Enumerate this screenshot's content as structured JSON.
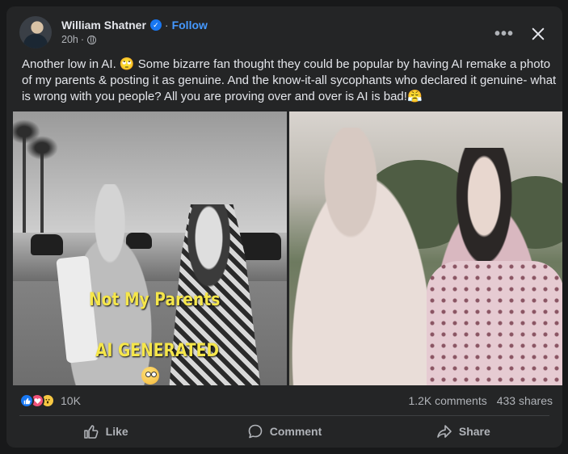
{
  "post": {
    "author": "William Shatner",
    "separator": "·",
    "follow_label": "Follow",
    "time": "20h",
    "time_separator": "·",
    "text": "Another low in AI. 🙄 Some bizarre fan thought they could be popular by having AI remake a photo of my parents & posting it as genuine. And the  know-it-all sycophants who declared it genuine- what is wrong with you people? All you are proving over and over is AI is bad!😤",
    "more_label": "•••",
    "verified_mark": "✓"
  },
  "media": {
    "left_caption_line1": "Not My Parents",
    "left_caption_line2": "AI  GENERATED"
  },
  "stats": {
    "reaction_count": "10K",
    "comments": "1.2K comments",
    "shares": "433 shares",
    "reaction_icons": [
      "like-icon",
      "love-icon",
      "wow-icon"
    ]
  },
  "actions": {
    "like": "Like",
    "comment": "Comment",
    "share": "Share"
  },
  "colors": {
    "background": "#18191a",
    "card": "#242526",
    "accent": "#4599ff",
    "caption": "#f5e64b"
  }
}
